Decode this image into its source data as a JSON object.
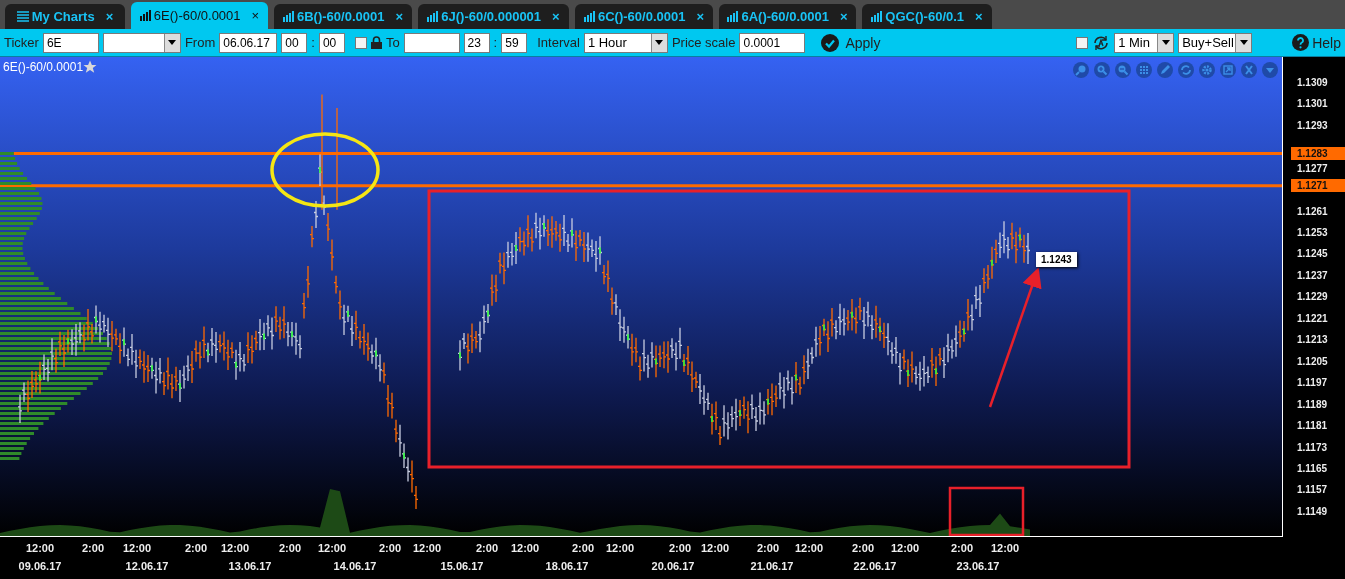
{
  "tabs": [
    {
      "label": "My Charts",
      "kind": "menu",
      "close": "×",
      "selected": false
    },
    {
      "label": "6E()-60/0.0001",
      "kind": "chart",
      "close": "×",
      "selected": true
    },
    {
      "label": "6B()-60/0.0001",
      "kind": "chart",
      "close": "×",
      "selected": false
    },
    {
      "label": "6J()-60/0.000001",
      "kind": "chart",
      "close": "×",
      "selected": false
    },
    {
      "label": "6C()-60/0.0001",
      "kind": "chart",
      "close": "×",
      "selected": false
    },
    {
      "label": "6A()-60/0.0001",
      "kind": "chart",
      "close": "×",
      "selected": false
    },
    {
      "label": "QGC()-60/0.1",
      "kind": "chart",
      "close": "×",
      "selected": false
    }
  ],
  "toolbar": {
    "ticker_label": "Ticker",
    "ticker": "6E",
    "from_label": "From",
    "from_date": "06.06.17",
    "from_hour": "00",
    "from_sep": ":",
    "from_minute": "00",
    "lock_checked": false,
    "to_label": "To",
    "to_hour": "23",
    "to_sep": ":",
    "to_minute": "59",
    "interval_label": "Interval",
    "interval": "1 Hour",
    "price_scale_label": "Price scale",
    "price_scale": "0.0001",
    "apply": "Apply",
    "auto_checked": false,
    "period": "1 Min",
    "side": "Buy+Sell",
    "help": "Help"
  },
  "chart": {
    "title": "6E()-60/0.0001",
    "favorite": false,
    "price_axis": [
      "1.1309",
      "1.1301",
      "1.1293",
      "1.1277",
      "1.1261",
      "1.1253",
      "1.1245",
      "1.1237",
      "1.1229",
      "1.1221",
      "1.1213",
      "1.1205",
      "1.1197",
      "1.1189",
      "1.1181",
      "1.1173",
      "1.1165",
      "1.1157",
      "1.1149"
    ],
    "levels": [
      "1.1283",
      "1.1271"
    ],
    "last_price": "1.1243",
    "time_axis": {
      "times": [
        "12:00",
        "2:00",
        "12:00",
        "2:00",
        "12:00",
        "2:00",
        "12:00",
        "2:00",
        "12:00",
        "2:00",
        "12:00",
        "2:00",
        "12:00",
        "2:00",
        "12:00",
        "2:00",
        "12:00",
        "2:00",
        "12:00",
        "2:00",
        "12:00"
      ],
      "dates": [
        "09.06.17",
        "12.06.17",
        "13.06.17",
        "14.06.17",
        "15.06.17",
        "18.06.17",
        "20.06.17",
        "21.06.17",
        "22.06.17",
        "23.06.17"
      ]
    }
  }
}
